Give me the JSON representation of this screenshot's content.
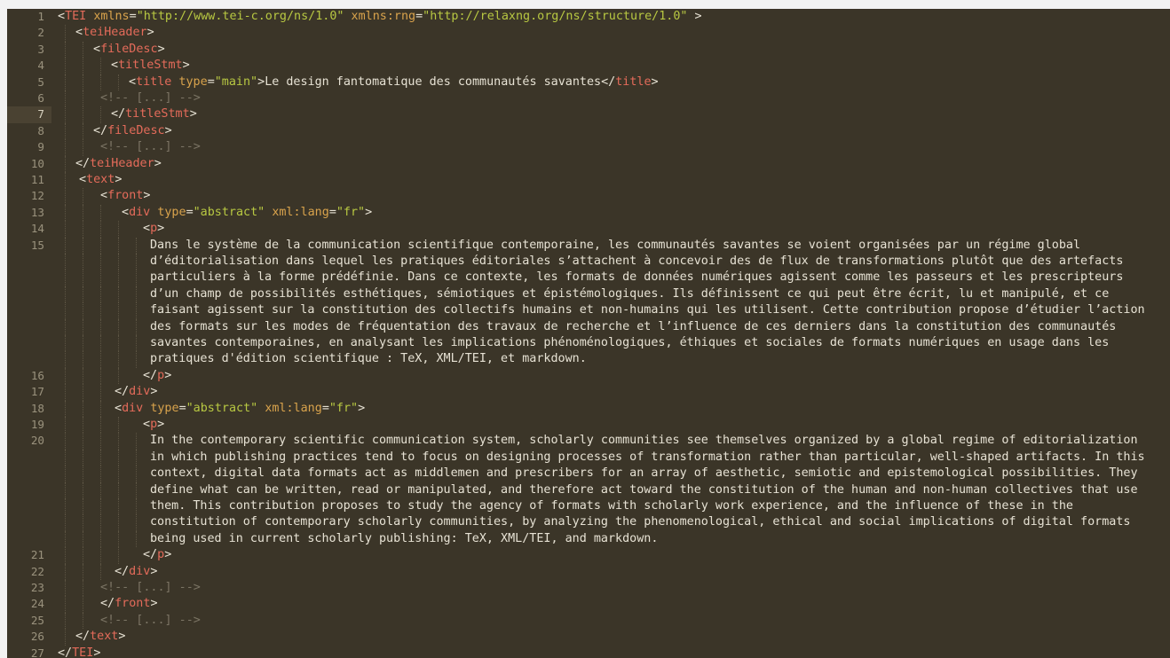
{
  "editor": {
    "active_line": 7,
    "lines": [
      {
        "n": "1",
        "indent": 0,
        "tokens": [
          [
            "punct",
            "<"
          ],
          [
            "tag",
            "TEI"
          ],
          [
            "punct",
            " "
          ],
          [
            "attr",
            "xmlns"
          ],
          [
            "punct",
            "="
          ],
          [
            "str",
            "\"http://www.tei-c.org/ns/1.0\""
          ],
          [
            "punct",
            " "
          ],
          [
            "attr",
            "xmlns:rng"
          ],
          [
            "punct",
            "="
          ],
          [
            "str",
            "\"http://relaxng.org/ns/structure/1.0\""
          ],
          [
            "punct",
            " >"
          ]
        ]
      },
      {
        "n": "2",
        "indent": 1,
        "tokens": [
          [
            "punct",
            "<"
          ],
          [
            "tag",
            "teiHeader"
          ],
          [
            "punct",
            ">"
          ]
        ]
      },
      {
        "n": "3",
        "indent": 2,
        "tokens": [
          [
            "punct",
            "<"
          ],
          [
            "tag",
            "fileDesc"
          ],
          [
            "punct",
            ">"
          ]
        ]
      },
      {
        "n": "4",
        "indent": 3,
        "tokens": [
          [
            "punct",
            "<"
          ],
          [
            "tag",
            "titleStmt"
          ],
          [
            "punct",
            ">"
          ]
        ]
      },
      {
        "n": "5",
        "indent": 4,
        "tokens": [
          [
            "punct",
            "<"
          ],
          [
            "tag",
            "title"
          ],
          [
            "punct",
            " "
          ],
          [
            "attr",
            "type"
          ],
          [
            "punct",
            "="
          ],
          [
            "str",
            "\"main\""
          ],
          [
            "punct",
            ">"
          ],
          [
            "txt",
            "Le design fantomatique des communautés savantes"
          ],
          [
            "punct",
            "</"
          ],
          [
            "tag",
            "title"
          ],
          [
            "punct",
            ">"
          ]
        ]
      },
      {
        "n": "6",
        "indent": 2.4,
        "tokens": [
          [
            "cmt",
            "<!-- [...] -->"
          ]
        ]
      },
      {
        "n": "7",
        "indent": 3,
        "tokens": [
          [
            "punct",
            "</"
          ],
          [
            "tag",
            "titleStmt"
          ],
          [
            "punct",
            ">"
          ]
        ]
      },
      {
        "n": "8",
        "indent": 2,
        "tokens": [
          [
            "punct",
            "</"
          ],
          [
            "tag",
            "fileDesc"
          ],
          [
            "punct",
            ">"
          ]
        ]
      },
      {
        "n": "9",
        "indent": 2.4,
        "tokens": [
          [
            "cmt",
            "<!-- [...] -->"
          ]
        ]
      },
      {
        "n": "10",
        "indent": 1,
        "tokens": [
          [
            "punct",
            "</"
          ],
          [
            "tag",
            "teiHeader"
          ],
          [
            "punct",
            ">"
          ]
        ]
      },
      {
        "n": "11",
        "indent": 1.2,
        "tokens": [
          [
            "punct",
            "<"
          ],
          [
            "tag",
            "text"
          ],
          [
            "punct",
            ">"
          ]
        ]
      },
      {
        "n": "12",
        "indent": 2.4,
        "tokens": [
          [
            "punct",
            "<"
          ],
          [
            "tag",
            "front"
          ],
          [
            "punct",
            ">"
          ]
        ]
      },
      {
        "n": "13",
        "indent": 3.6,
        "tokens": [
          [
            "punct",
            "<"
          ],
          [
            "tag",
            "div"
          ],
          [
            "punct",
            " "
          ],
          [
            "attr",
            "type"
          ],
          [
            "punct",
            "="
          ],
          [
            "str",
            "\"abstract\""
          ],
          [
            "punct",
            " "
          ],
          [
            "attr",
            "xml:lang"
          ],
          [
            "punct",
            "="
          ],
          [
            "str",
            "\"fr\""
          ],
          [
            "punct",
            ">"
          ]
        ]
      },
      {
        "n": "14",
        "indent": 4.8,
        "tokens": [
          [
            "punct",
            "<"
          ],
          [
            "tag",
            "p"
          ],
          [
            "punct",
            ">"
          ]
        ]
      },
      {
        "n": "15",
        "indent": 5.2,
        "tokens": [
          [
            "txt",
            "Dans le système de la communication scientifique contemporaine, les communautés savantes se voient organisées par un régime global"
          ]
        ]
      },
      {
        "n": "",
        "indent": 5.2,
        "tokens": [
          [
            "txt",
            "d’éditorialisation dans lequel les pratiques éditoriales s’attachent à concevoir des de flux de transformations plutôt que des artefacts"
          ]
        ]
      },
      {
        "n": "",
        "indent": 5.2,
        "tokens": [
          [
            "txt",
            "particuliers à la forme prédéfinie. Dans ce contexte, les formats de données numériques agissent comme les passeurs et les prescripteurs"
          ]
        ]
      },
      {
        "n": "",
        "indent": 5.2,
        "tokens": [
          [
            "txt",
            "d’un champ de possibilités esthétiques, sémiotiques et épistémologiques. Ils définissent ce qui peut être écrit, lu et manipulé, et ce"
          ]
        ]
      },
      {
        "n": "",
        "indent": 5.2,
        "tokens": [
          [
            "txt",
            "faisant agissent sur la constitution des collectifs humains et non-humains qui les utilisent. Cette contribution propose d’étudier l’action"
          ]
        ]
      },
      {
        "n": "",
        "indent": 5.2,
        "tokens": [
          [
            "txt",
            "des formats sur les modes de fréquentation des travaux de recherche et l’influence de ces derniers dans la constitution des communautés"
          ]
        ]
      },
      {
        "n": "",
        "indent": 5.2,
        "tokens": [
          [
            "txt",
            "savantes contemporaines, en analysant les implications phénoménologiques, éthiques et sociales de formats numériques en usage dans les"
          ]
        ]
      },
      {
        "n": "",
        "indent": 5.2,
        "tokens": [
          [
            "txt",
            "pratiques d'édition scientifique : TeX, XML/TEI, et markdown."
          ]
        ]
      },
      {
        "n": "16",
        "indent": 4.8,
        "tokens": [
          [
            "punct",
            "</"
          ],
          [
            "tag",
            "p"
          ],
          [
            "punct",
            ">"
          ]
        ]
      },
      {
        "n": "17",
        "indent": 3.2,
        "tokens": [
          [
            "punct",
            "</"
          ],
          [
            "tag",
            "div"
          ],
          [
            "punct",
            ">"
          ]
        ]
      },
      {
        "n": "18",
        "indent": 3.2,
        "tokens": [
          [
            "punct",
            "<"
          ],
          [
            "tag",
            "div"
          ],
          [
            "punct",
            " "
          ],
          [
            "attr",
            "type"
          ],
          [
            "punct",
            "="
          ],
          [
            "str",
            "\"abstract\""
          ],
          [
            "punct",
            " "
          ],
          [
            "attr",
            "xml:lang"
          ],
          [
            "punct",
            "="
          ],
          [
            "str",
            "\"fr\""
          ],
          [
            "punct",
            ">"
          ]
        ]
      },
      {
        "n": "19",
        "indent": 4.8,
        "tokens": [
          [
            "punct",
            "<"
          ],
          [
            "tag",
            "p"
          ],
          [
            "punct",
            ">"
          ]
        ]
      },
      {
        "n": "20",
        "indent": 5.2,
        "tokens": [
          [
            "txt",
            "In the contemporary scientific communication system, scholarly communities see themselves organized by a global regime of editorialization"
          ]
        ]
      },
      {
        "n": "",
        "indent": 5.2,
        "tokens": [
          [
            "txt",
            "in which publishing practices tend to focus on designing processes of transformation rather than particular, well-shaped artifacts. In this"
          ]
        ]
      },
      {
        "n": "",
        "indent": 5.2,
        "tokens": [
          [
            "txt",
            "context, digital data formats act as middlemen and prescribers for an array of aesthetic, semiotic and epistemological possibilities. They"
          ]
        ]
      },
      {
        "n": "",
        "indent": 5.2,
        "tokens": [
          [
            "txt",
            "define what can be written, read or manipulated, and therefore act toward the constitution of the human and non-human collectives that use"
          ]
        ]
      },
      {
        "n": "",
        "indent": 5.2,
        "tokens": [
          [
            "txt",
            "them. This contribution proposes to study the agency of formats with scholarly work experience, and the influence of these in the"
          ]
        ]
      },
      {
        "n": "",
        "indent": 5.2,
        "tokens": [
          [
            "txt",
            "constitution of contemporary scholarly communities, by analyzing the phenomenological, ethical and social implications of digital formats"
          ]
        ]
      },
      {
        "n": "",
        "indent": 5.2,
        "tokens": [
          [
            "txt",
            "being used in current scholarly publishing: TeX, XML/TEI, and markdown."
          ]
        ]
      },
      {
        "n": "21",
        "indent": 4.8,
        "tokens": [
          [
            "punct",
            "</"
          ],
          [
            "tag",
            "p"
          ],
          [
            "punct",
            ">"
          ]
        ]
      },
      {
        "n": "22",
        "indent": 3.2,
        "tokens": [
          [
            "punct",
            "</"
          ],
          [
            "tag",
            "div"
          ],
          [
            "punct",
            ">"
          ]
        ]
      },
      {
        "n": "23",
        "indent": 2.4,
        "tokens": [
          [
            "cmt",
            "<!-- [...] -->"
          ]
        ]
      },
      {
        "n": "24",
        "indent": 2.4,
        "tokens": [
          [
            "punct",
            "</"
          ],
          [
            "tag",
            "front"
          ],
          [
            "punct",
            ">"
          ]
        ]
      },
      {
        "n": "25",
        "indent": 2.4,
        "tokens": [
          [
            "cmt",
            "<!-- [...] -->"
          ]
        ]
      },
      {
        "n": "26",
        "indent": 1,
        "tokens": [
          [
            "punct",
            "</"
          ],
          [
            "tag",
            "text"
          ],
          [
            "punct",
            ">"
          ]
        ]
      },
      {
        "n": "27",
        "indent": 0,
        "tokens": [
          [
            "punct",
            "</"
          ],
          [
            "tag",
            "TEI"
          ],
          [
            "punct",
            ">"
          ]
        ]
      }
    ]
  }
}
